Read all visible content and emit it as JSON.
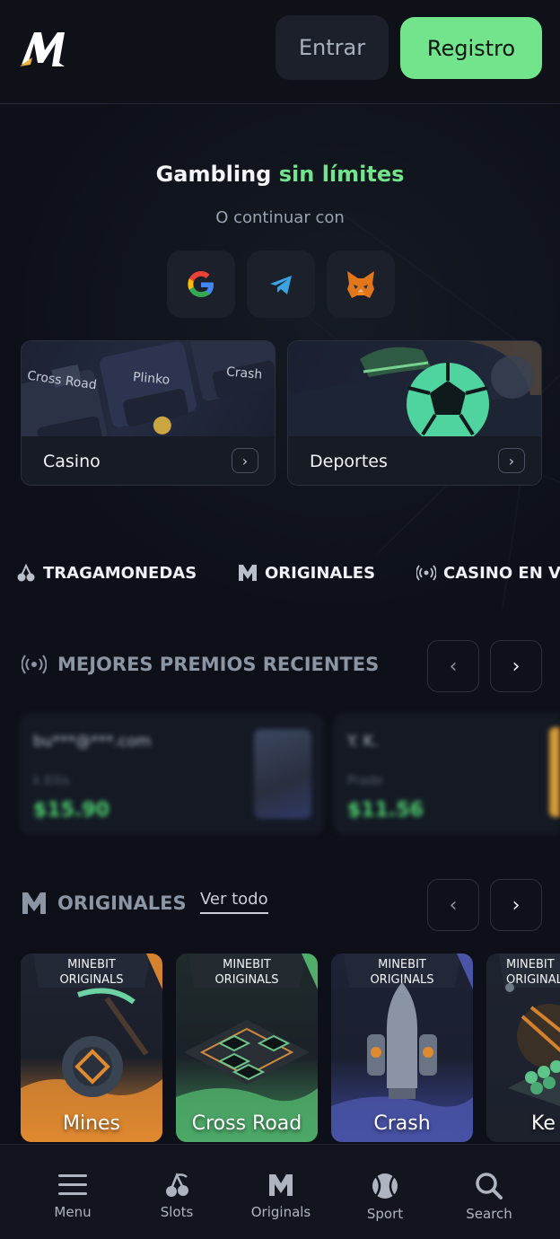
{
  "header": {
    "logo_name": "minebit-logo",
    "login_label": "Entrar",
    "register_label": "Registro"
  },
  "hero": {
    "title_part1": "Gambling",
    "title_part2": "sin límites",
    "continue_text": "O continuar con",
    "social": [
      "google-icon",
      "telegram-icon",
      "metamask-icon"
    ]
  },
  "categories": [
    {
      "label": "Casino",
      "art_labels": [
        "Cross Road",
        "Plinko",
        "Crash"
      ]
    },
    {
      "label": "Deportes"
    }
  ],
  "nav_tabs": [
    {
      "label": "TRAGAMONEDAS",
      "icon": "cherries-icon"
    },
    {
      "label": "ORIGINALES",
      "icon": "m-logo-icon"
    },
    {
      "label": "CASINO EN VI",
      "icon": "live-broadcast-icon"
    }
  ],
  "recent_wins": {
    "title": "MEJORES PREMIOS RECIENTES",
    "cards": [
      {
        "user": "bu***@***.com",
        "game": "k Ellis",
        "amount": "$15.90"
      },
      {
        "user": "Y. K.",
        "game": "Prado",
        "amount": "$11.56"
      }
    ]
  },
  "originals": {
    "title": "ORIGINALES",
    "see_all": "Ver todo",
    "games": [
      {
        "brand_line1": "MINEBIT",
        "brand_line2": "ORIGINALS",
        "name": "Mines",
        "accent": "#d4822e"
      },
      {
        "brand_line1": "MINEBIT",
        "brand_line2": "ORIGINALS",
        "name": "Cross Road",
        "accent": "#4fae6a"
      },
      {
        "brand_line1": "MINEBIT",
        "brand_line2": "ORIGINALS",
        "name": "Crash",
        "accent": "#4a55a8"
      },
      {
        "brand_line1": "MINEBIT",
        "brand_line2": "ORIGINALS",
        "name": "Ke",
        "accent": "#6d7a86"
      }
    ]
  },
  "bottom_nav": [
    {
      "label": "Menu",
      "icon": "hamburger-icon"
    },
    {
      "label": "Slots",
      "icon": "cherries-icon"
    },
    {
      "label": "Originals",
      "icon": "m-logo-icon"
    },
    {
      "label": "Sport",
      "icon": "tennis-ball-icon"
    },
    {
      "label": "Search",
      "icon": "search-icon"
    }
  ],
  "colors": {
    "accent_green": "#72e48c",
    "background": "#0d1018",
    "surface": "#1b202a"
  }
}
